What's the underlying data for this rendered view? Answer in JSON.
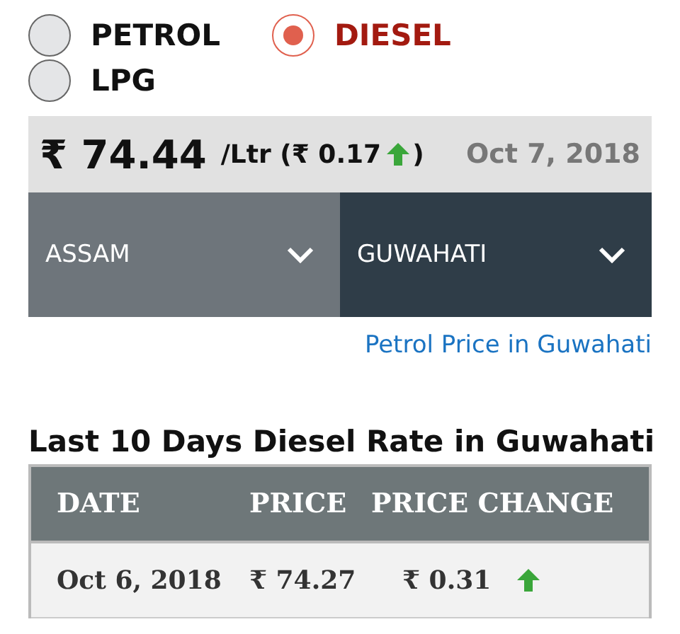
{
  "fuel_options": [
    {
      "label": "PETROL",
      "selected": false
    },
    {
      "label": "DIESEL",
      "selected": true
    },
    {
      "label": "LPG",
      "selected": false
    }
  ],
  "price": {
    "currency": "₹",
    "value": "74.44",
    "unit": "/Ltr",
    "change_open": "(",
    "change_currency": "₹",
    "change": "0.17",
    "rising": true,
    "change_close": ")",
    "date": "Oct 7, 2018"
  },
  "selects": [
    {
      "value": "ASSAM",
      "kind": "state"
    },
    {
      "value": "GUWAHATI",
      "kind": "city"
    }
  ],
  "link": "Petrol Price in Guwahati",
  "table": {
    "title": "Last 10 Days Diesel Rate in Guwahati",
    "columns": [
      "DATE",
      "PRICE",
      "PRICE CHANGE"
    ],
    "rows": [
      {
        "date": "Oct 6, 2018",
        "price": "₹ 74.27",
        "change": "₹ 0.31",
        "rising": true
      }
    ]
  }
}
